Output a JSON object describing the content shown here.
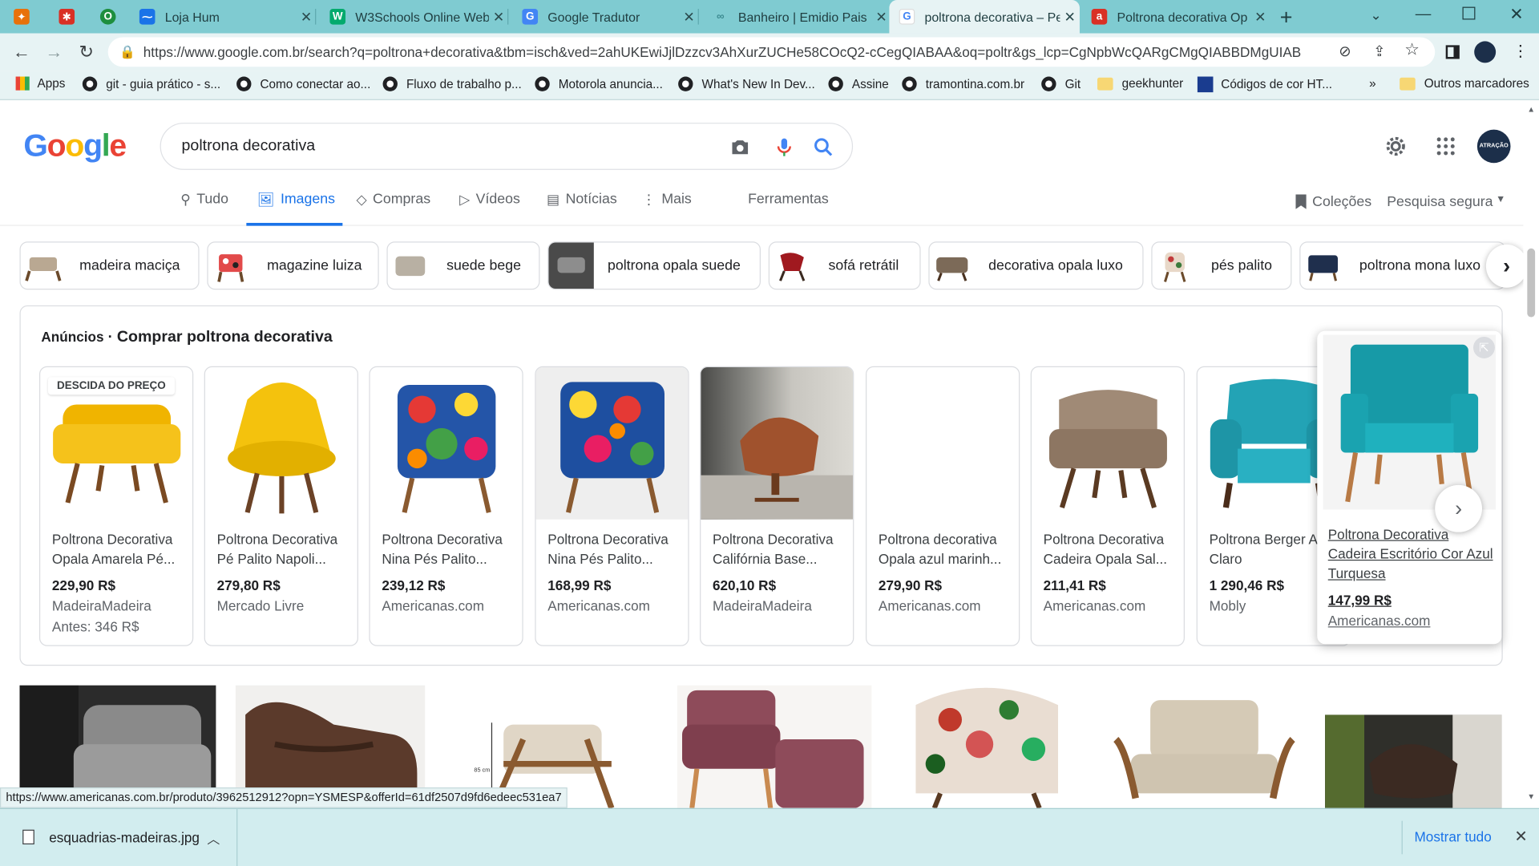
{
  "browser": {
    "tabs": [
      {
        "title": "",
        "icon": "pinned-app-icon",
        "color": "#e8710a"
      },
      {
        "title": "",
        "icon": "pinned-asterisk-icon",
        "color": "#d93025"
      },
      {
        "title": "",
        "icon": "pinned-opera-icon",
        "color": "#1e8e3e"
      },
      {
        "title": "Loja Hum",
        "icon": "swoosh-icon",
        "color": "#1a73e8"
      },
      {
        "title": "W3Schools Online Web",
        "icon": "w3schools-icon",
        "color": "#04aa6d"
      },
      {
        "title": "Google Tradutor",
        "icon": "translate-icon",
        "color": "#4285f4"
      },
      {
        "title": "Banheiro | Emidio Pais",
        "icon": "link-icon",
        "color": "#7fcbd1"
      },
      {
        "title": "poltrona decorativa – Pe",
        "icon": "google-icon",
        "color": "#4285f4"
      },
      {
        "title": "Poltrona decorativa Op",
        "icon": "madeira-icon",
        "color": "#d93025"
      }
    ],
    "url": "https://www.google.com.br/search?q=poltrona+decorativa&tbm=isch&ved=2ahUKEwiJjlDzzcv3AhXurZUCHe58COcQ2-cCegQIABAA&oq=poltr&gs_lcp=CgNpbWcQARgCMgQIABBDMgUIAB...",
    "bookmarks": [
      {
        "label": "Apps",
        "type": "apps"
      },
      {
        "label": "git - guia prático - s...",
        "type": "globe"
      },
      {
        "label": "Como conectar ao...",
        "type": "globe"
      },
      {
        "label": "Fluxo de trabalho p...",
        "type": "globe"
      },
      {
        "label": "Motorola anuncia...",
        "type": "globe"
      },
      {
        "label": "What's New In Dev...",
        "type": "globe"
      },
      {
        "label": "Assine",
        "type": "globe"
      },
      {
        "label": "tramontina.com.br",
        "type": "globe"
      },
      {
        "label": "Git",
        "type": "globe"
      },
      {
        "label": "geekhunter",
        "type": "folder"
      },
      {
        "label": "Códigos de cor HT...",
        "type": "dansdocs"
      }
    ],
    "bookmarks_more": "»",
    "other_bookmarks": "Outros marcadores"
  },
  "google": {
    "logo": "Google",
    "query": "poltrona decorativa",
    "tabs": [
      "Tudo",
      "Imagens",
      "Compras",
      "Vídeos",
      "Notícias",
      "Mais"
    ],
    "tools": "Ferramentas",
    "collections": "Coleções",
    "safe_search": "Pesquisa segura",
    "avatar_text": "ATRAÇÃO",
    "chips": [
      "madeira maciça",
      "magazine luiza",
      "suede bege",
      "poltrona opala suede",
      "sofá retrátil",
      "decorativa opala luxo",
      "pés palito",
      "poltrona mona luxo"
    ]
  },
  "ads": {
    "label": "Anúncios",
    "title": "Comprar poltrona decorativa",
    "badge": "DESCIDA DO PREÇO",
    "cards": [
      {
        "title": "Poltrona Decorativa Opala Amarela Pé...",
        "price": "229,90 R$",
        "seller": "MadeiraMadeira",
        "old": "Antes: 346 R$",
        "image": "yellow-armchair",
        "color": "#f2b705"
      },
      {
        "title": "Poltrona Decorativa Pé Palito Napoli...",
        "price": "279,80 R$",
        "seller": "Mercado Livre",
        "old": "",
        "image": "yellow-egg-chair",
        "color": "#f4c20d"
      },
      {
        "title": "Poltrona Decorativa Nina Pés Palito...",
        "price": "239,12 R$",
        "seller": "Americanas.com",
        "old": "",
        "image": "colorful-armchair",
        "color": "#c2185b"
      },
      {
        "title": "Poltrona Decorativa Nina Pés Palito...",
        "price": "168,99 R$",
        "seller": "Americanas.com",
        "old": "",
        "image": "colorful-armchair-2",
        "color": "#1565c0"
      },
      {
        "title": "Poltrona Decorativa Califórnia Base...",
        "price": "620,10 R$",
        "seller": "MadeiraMadeira",
        "old": "",
        "image": "brown-swivel-chair",
        "color": "#a0522d"
      },
      {
        "title": "Poltrona decorativa Opala azul marinh...",
        "price": "279,90 R$",
        "seller": "Americanas.com",
        "old": "",
        "image": "",
        "color": "#ffffff"
      },
      {
        "title": "Poltrona Decorativa Cadeira Opala Sal...",
        "price": "211,41 R$",
        "seller": "Americanas.com",
        "old": "",
        "image": "beige-opala-chair",
        "color": "#9c8672"
      },
      {
        "title": "Poltrona Berger Azul Claro",
        "price": "1 290,46 R$",
        "seller": "Mobly",
        "old": "",
        "image": "turquoise-berger-chair",
        "color": "#26a7b8"
      }
    ],
    "popup": {
      "title": "Poltrona Decorativa Cadeira Escritório Cor Azul Turquesa",
      "price": "147,99 R$",
      "seller": "Americanas.com",
      "color": "#1aa3b0"
    }
  },
  "results": [
    {
      "image": "gray-recliner",
      "color": "#6d6d6d"
    },
    {
      "image": "brown-armchair",
      "color": "#5b3a2b"
    },
    {
      "image": "beige-wood-chair",
      "color": "#d8cdbd"
    },
    {
      "image": "mauve-pair-chairs",
      "color": "#8e4b5a"
    },
    {
      "image": "floral-tub-chair",
      "color": "#e9ddd2"
    },
    {
      "image": "cream-wood-armchair",
      "color": "#cfc4b0"
    },
    {
      "image": "dark-swivel-chair",
      "color": "#3b2a22"
    }
  ],
  "status_url": "https://www.americanas.com.br/produto/3962512912?opn=YSMESP&offerId=61df2507d9fd6edeec531ea7",
  "downloads": {
    "file": "esquadrias-madeiras.jpg",
    "show_all": "Mostrar tudo"
  }
}
